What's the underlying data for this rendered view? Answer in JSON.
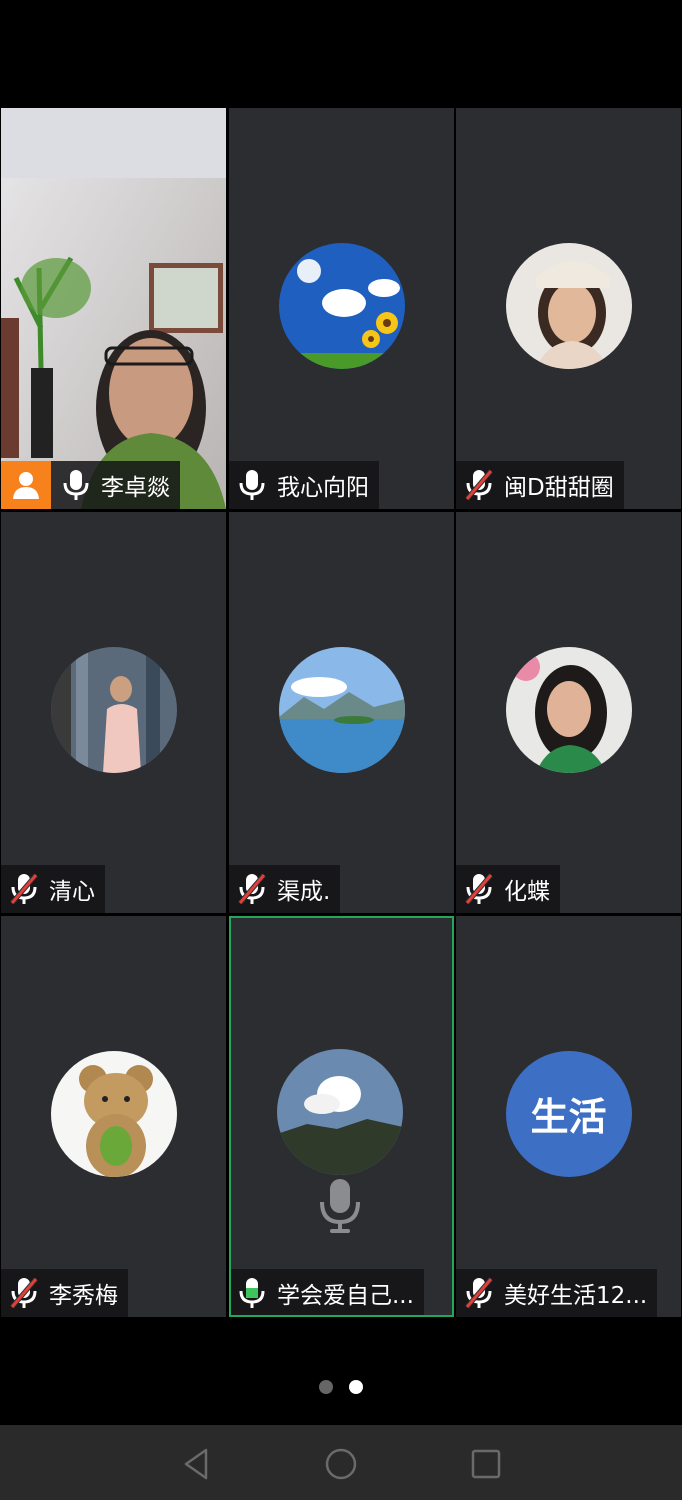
{
  "participants": [
    {
      "name": "李卓燚",
      "mic": "on",
      "host": true
    },
    {
      "name": "我心向阳",
      "mic": "on",
      "host": false
    },
    {
      "name": "闽D甜甜圈",
      "mic": "muted",
      "host": false
    },
    {
      "name": "清心",
      "mic": "muted",
      "host": false
    },
    {
      "name": "渠成.",
      "mic": "muted",
      "host": false
    },
    {
      "name": "化蝶",
      "mic": "muted",
      "host": false
    },
    {
      "name": "李秀梅",
      "mic": "muted",
      "host": false
    },
    {
      "name": "学会爱自己...",
      "mic": "speaking",
      "host": false
    },
    {
      "name": "美好生活12...",
      "mic": "muted",
      "host": false
    }
  ],
  "text_avatar_label": "生活",
  "pager": {
    "pages": 2,
    "current": 2
  },
  "colors": {
    "tile_bg": "#2b2d31",
    "active_border": "#22a85a",
    "host_badge": "#f7821b",
    "muted_slash": "#e0403a",
    "speaking_mic": "#3ec45b",
    "text_avatar_bg": "#3d6fc4"
  },
  "icons": [
    "person-icon",
    "microphone-icon",
    "microphone-muted-icon",
    "nav-back-icon",
    "nav-home-icon",
    "nav-recents-icon"
  ]
}
